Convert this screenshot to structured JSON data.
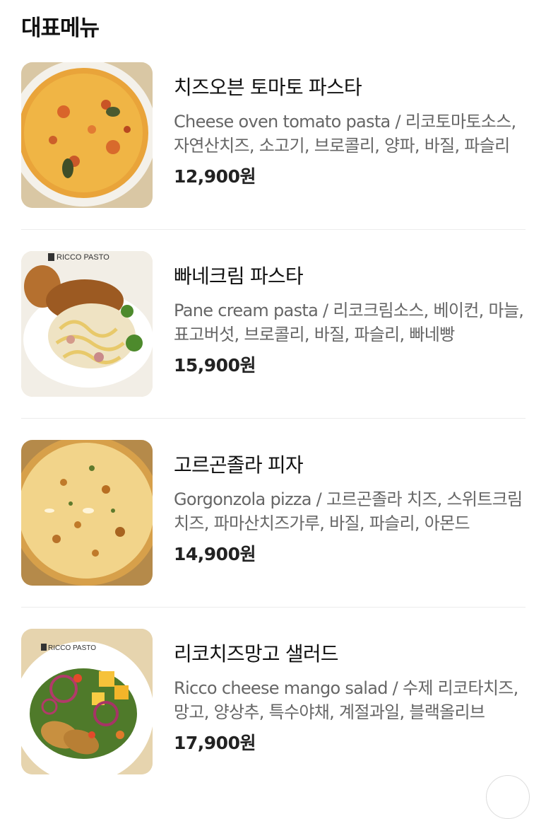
{
  "section": {
    "title": "대표메뉴"
  },
  "menu": [
    {
      "name": "치즈오븐 토마토 파스타",
      "description": "Cheese oven tomato pasta / 리코토마토소스, 자연산치즈, 소고기, 브로콜리, 양파, 바질, 파슬리",
      "price": "12,900원",
      "image_icon": "cheese-oven-pasta-photo"
    },
    {
      "name": "빠네크림 파스타",
      "description": "Pane cream pasta / 리코크림소스, 베이컨, 마늘, 표고버섯, 브로콜리, 바질, 파슬리, 빠네빵",
      "price": "15,900원",
      "image_icon": "pane-cream-pasta-photo",
      "image_logo_text": "RICCO PASTO"
    },
    {
      "name": "고르곤졸라 피자",
      "description": "Gorgonzola pizza / 고르곤졸라 치즈, 스위트크림치즈, 파마산치즈가루, 바질, 파슬리, 아몬드",
      "price": "14,900원",
      "image_icon": "gorgonzola-pizza-photo"
    },
    {
      "name": "리코치즈망고 샐러드",
      "description": "Ricco cheese mango salad / 수제 리코타치즈, 망고, 양상추, 특수야채, 계절과일, 블랙올리브",
      "price": "17,900원",
      "image_icon": "mango-salad-photo",
      "image_logo_text": "RICCO PASTO"
    }
  ]
}
